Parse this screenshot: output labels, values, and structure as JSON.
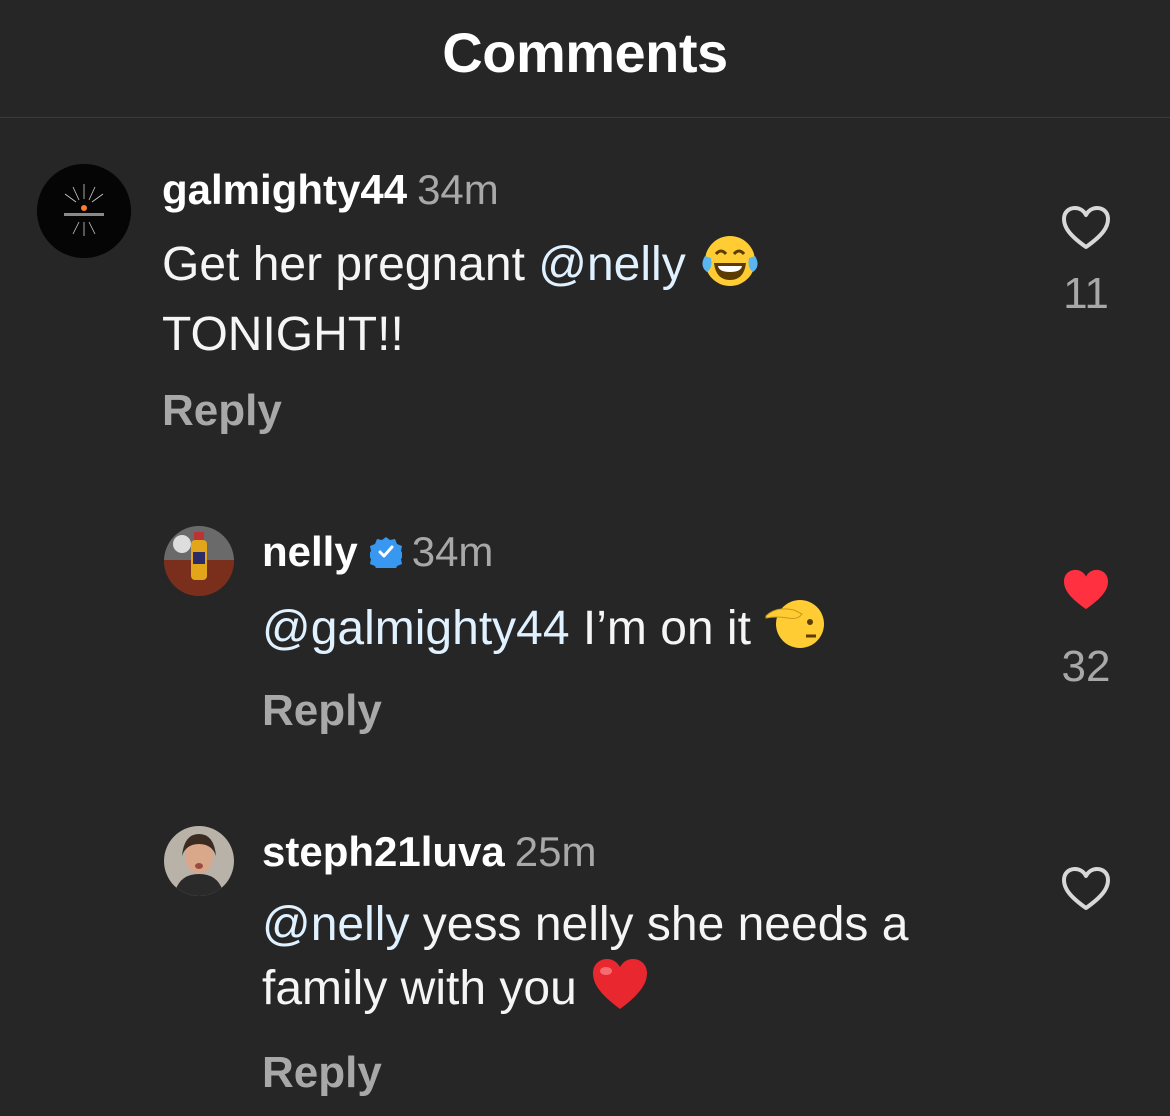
{
  "header": {
    "title": "Comments"
  },
  "comments": [
    {
      "username": "galmighty44",
      "time": "34m",
      "mention": "",
      "text_before_mention": "Get her pregnant ",
      "mention_text": "@nelly",
      "line2": "TONIGHT!!",
      "emoji": "face-with-tears-of-joy-icon",
      "reply_label": "Reply",
      "likes": "11",
      "liked": false
    },
    {
      "username": "nelly",
      "verified": true,
      "time": "34m",
      "mention_text": "@galmighty44",
      "text_after_mention": " I’m on it ",
      "emoji": "saluting-face-icon",
      "reply_label": "Reply",
      "likes": "32",
      "liked": true
    },
    {
      "username": "steph21luva",
      "time": "25m",
      "mention_text": "@nelly",
      "text_after_mention": " yess nelly she needs a",
      "line2": "family with you ",
      "emoji": "red-heart-icon",
      "reply_label": "Reply",
      "likes": "",
      "liked": false
    }
  ],
  "colors": {
    "background": "#262626",
    "mention": "#e0f1ff",
    "muted": "#a8a8a8",
    "like_red": "#ff3040",
    "verified_blue": "#3897f0"
  }
}
